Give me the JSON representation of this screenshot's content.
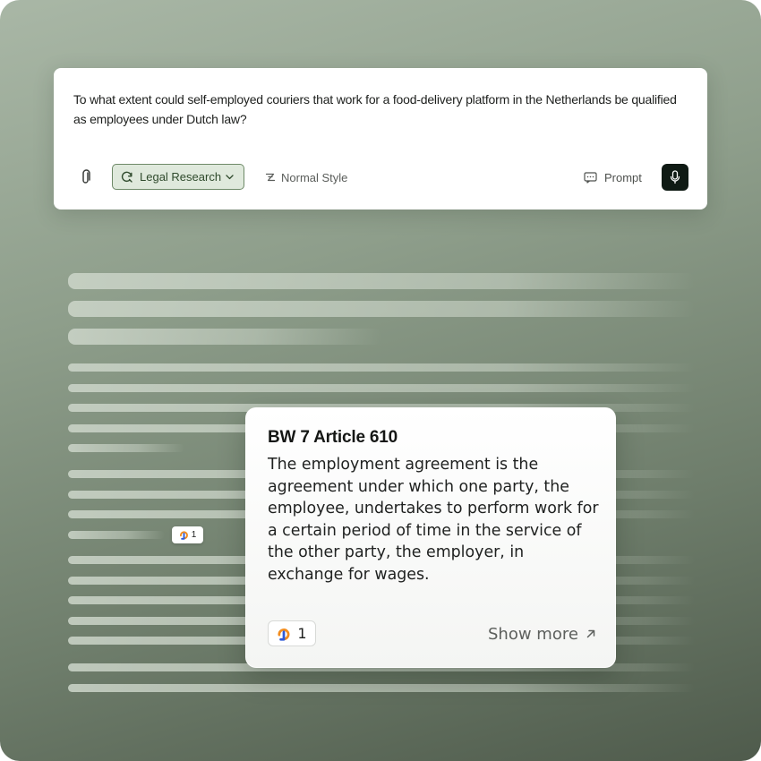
{
  "prompt": {
    "text": "To what extent could self-employed couriers that work for a food-delivery platform in the Netherlands be qualified as employees under Dutch law?"
  },
  "toolbar": {
    "mode_label": "Legal Research",
    "style_label": "Normal Style",
    "prompt_label": "Prompt",
    "icons": {
      "attach": "paperclip-icon",
      "mode": "refresh-search-icon",
      "mode_chevron": "chevron-down-icon",
      "style": "style-icon",
      "prompt": "message-icon",
      "mic": "microphone-icon"
    }
  },
  "inline_citation": {
    "count": "1",
    "icon": "source-logo-icon"
  },
  "popover": {
    "title": "BW 7 Article 610",
    "body": "The employment agreement is the agreement under which one party, the employee, undertakes to perform work for a certain period of time in the service of the other party, the employer, in exchange for wages.",
    "citation_count": "1",
    "show_more_label": "Show more",
    "icons": {
      "source": "source-logo-icon",
      "show_more": "arrow-up-right-icon"
    }
  },
  "colors": {
    "background": "#8e9e8b",
    "accent_green": "#6e8a68",
    "mode_fill": "#dfe9dc",
    "mic_button": "#0f1a14",
    "logo_orange": "#f28c1e",
    "logo_blue": "#2f5bd8"
  }
}
